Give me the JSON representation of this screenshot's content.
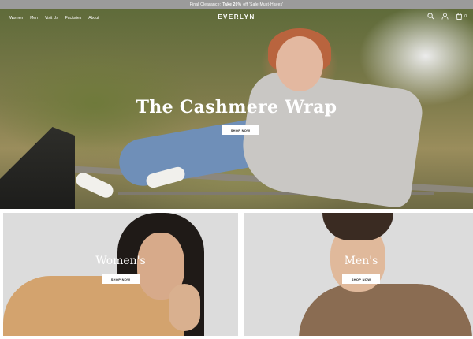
{
  "announcement": {
    "prefix": "Final Clearance:",
    "bold": "Take 20%",
    "suffix": "off 'Sale Must-Haves'"
  },
  "nav": {
    "links": [
      "Women",
      "Men",
      "Visit Us",
      "Factories",
      "About"
    ]
  },
  "brand": {
    "name": "EVERLYN"
  },
  "header_icons": {
    "search": "search-icon",
    "account": "user-icon",
    "cart": "bag-icon",
    "cart_count": "0"
  },
  "hero": {
    "title": "The Cashmere Wrap",
    "button": "SHOP NOW"
  },
  "categories": [
    {
      "title": "Women's",
      "button": "SHOP NOW"
    },
    {
      "title": "Men's",
      "button": "SHOP NOW"
    }
  ],
  "colors": {
    "announcement_bg": "#9b9b9b",
    "card_bg": "#dcdcdc",
    "text_on_image": "#ffffff"
  }
}
